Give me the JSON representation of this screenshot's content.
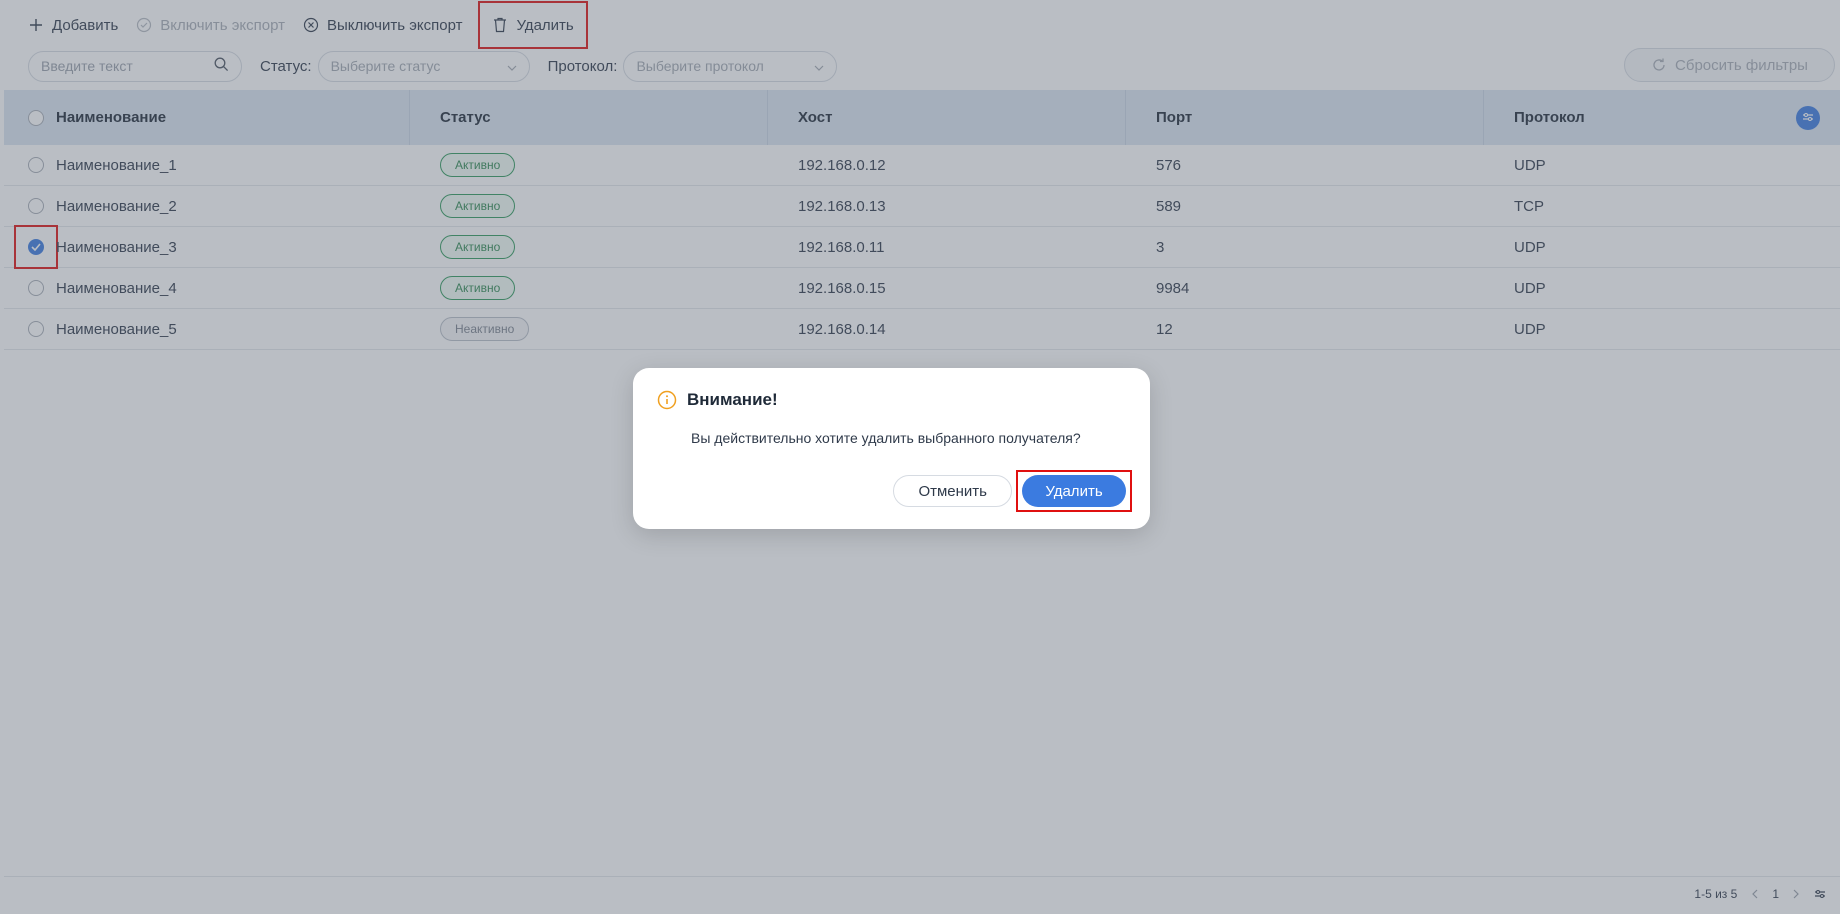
{
  "toolbar": {
    "add_label": "Добавить",
    "enable_export_label": "Включить экспорт",
    "disable_export_label": "Выключить экспорт",
    "delete_label": "Удалить"
  },
  "filters": {
    "search_placeholder": "Введите текст",
    "status_label": "Статус:",
    "status_placeholder": "Выберите статус",
    "protocol_label": "Протокол:",
    "protocol_placeholder": "Выберите протокол",
    "reset_label": "Сбросить фильтры"
  },
  "table": {
    "headers": {
      "name": "Наименование",
      "status": "Статус",
      "host": "Хост",
      "port": "Порт",
      "protocol": "Протокол"
    },
    "rows": [
      {
        "name": "Наименование_1",
        "status": "Активно",
        "host": "192.168.0.12",
        "port": "576",
        "protocol": "UDP"
      },
      {
        "name": "Наименование_2",
        "status": "Активно",
        "host": "192.168.0.13",
        "port": "589",
        "protocol": "TCP"
      },
      {
        "name": "Наименование_3",
        "status": "Активно",
        "host": "192.168.0.11",
        "port": "3",
        "protocol": "UDP"
      },
      {
        "name": "Наименование_4",
        "status": "Активно",
        "host": "192.168.0.15",
        "port": "9984",
        "protocol": "UDP"
      },
      {
        "name": "Наименование_5",
        "status": "Неактивно",
        "host": "192.168.0.14",
        "port": "12",
        "protocol": "UDP"
      }
    ]
  },
  "footer": {
    "range": "1-5 из 5",
    "page": "1"
  },
  "modal": {
    "title": "Внимание!",
    "text": "Вы действительно хотите удалить выбранного получателя?",
    "cancel_label": "Отменить",
    "confirm_label": "Удалить"
  },
  "colors": {
    "accent": "#3b7be0",
    "active": "#2f9a5c",
    "highlight": "#e01010",
    "warning": "#f0a020"
  }
}
